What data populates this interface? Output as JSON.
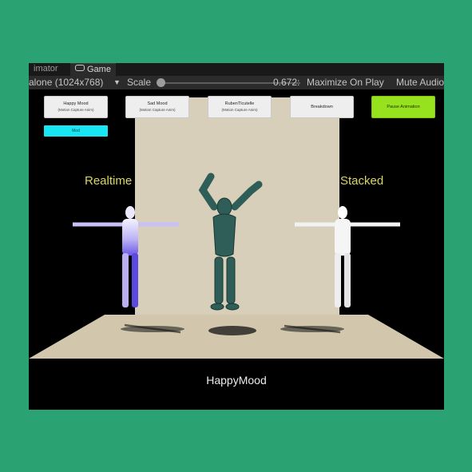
{
  "editor": {
    "tabs": [
      {
        "label": "imator"
      },
      {
        "label": "Game",
        "icon": "gamepad-icon"
      }
    ],
    "toolbar": {
      "resolution": "alone (1024x768)",
      "scale_label": "Scale",
      "scale_value": "0.672:",
      "maximize_label": "Maximize On Play",
      "mute_label": "Mute Audio"
    }
  },
  "game": {
    "buttons": [
      {
        "title": "Happy Mood",
        "subtitle": "(Motion Capture Anim)"
      },
      {
        "title": "Sad Mood",
        "subtitle": "(Motion Capture Anim)"
      },
      {
        "title": "RubenTlcutelle",
        "subtitle": "(Motion Capture Anim)"
      },
      {
        "title": "Breakdown",
        "subtitle": ""
      },
      {
        "title": "Pause Animation",
        "subtitle": "",
        "color": "#97e21f"
      }
    ],
    "mod_button": "Mod",
    "mod_color": "#18e6f2",
    "label_left": "Realtime",
    "label_right": "Stacked",
    "caption": "HappyMood",
    "label_color": "#d9d75e",
    "background_color": "#2aa272"
  }
}
